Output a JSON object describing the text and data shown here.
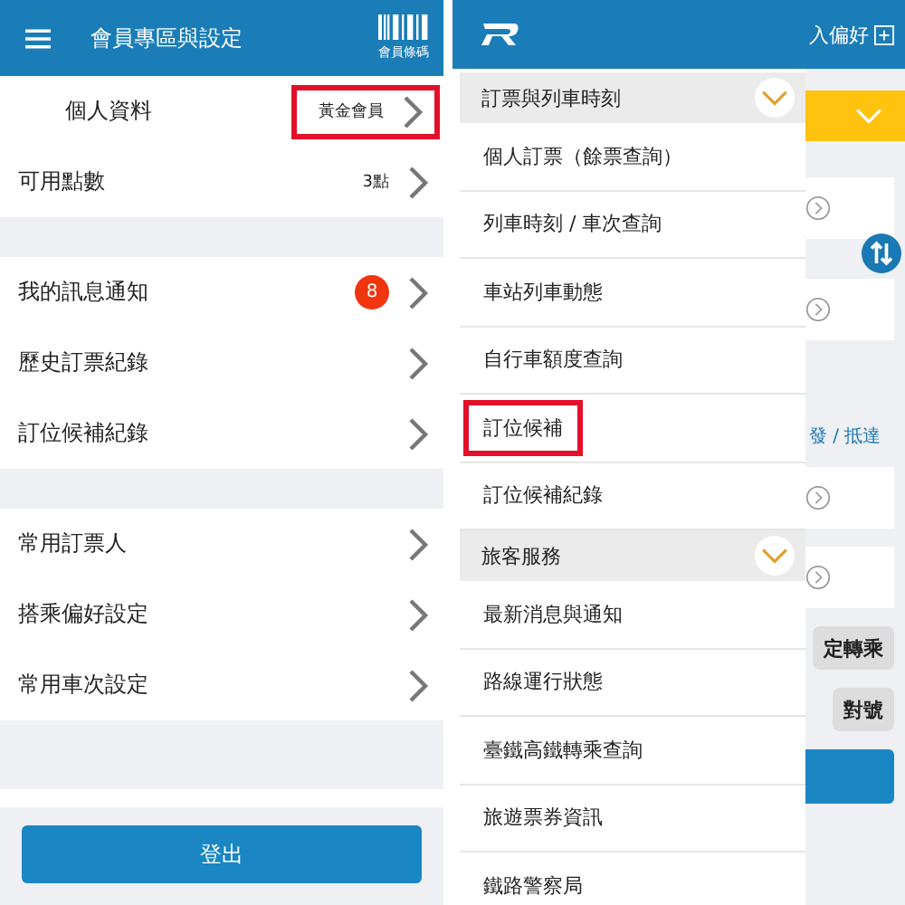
{
  "member_screen": {
    "header": {
      "title": "會員專區與設定",
      "member_code_label": "會員條碼"
    },
    "groups": [
      [
        {
          "label": "個人資料",
          "value": "黃金會員",
          "indented": true,
          "highlighted": true
        },
        {
          "label": "可用點數",
          "value": "3點",
          "indented": false,
          "highlighted": false
        }
      ],
      [
        {
          "label": "我的訊息通知",
          "badge": "8",
          "indented": false,
          "highlighted": false
        },
        {
          "label": "歷史訂票紀錄",
          "indented": false,
          "highlighted": false
        },
        {
          "label": "訂位候補紀錄",
          "indented": false,
          "highlighted": false
        }
      ],
      [
        {
          "label": "常用訂票人",
          "indented": false,
          "highlighted": false
        },
        {
          "label": "搭乘偏好設定",
          "indented": false,
          "highlighted": false
        },
        {
          "label": "常用車次設定",
          "indented": false,
          "highlighted": false
        }
      ]
    ],
    "logout_button": "登出"
  },
  "menu_screen": {
    "header": {
      "favorite_label": "入偏好"
    },
    "drawer": [
      {
        "kind": "section",
        "label": "訂票與列車時刻",
        "expanded": true
      },
      {
        "kind": "item",
        "label": "個人訂票（餘票查詢）",
        "highlighted": false
      },
      {
        "kind": "item",
        "label": "列車時刻 / 車次查詢",
        "highlighted": false
      },
      {
        "kind": "item",
        "label": "車站列車動態",
        "highlighted": false
      },
      {
        "kind": "item",
        "label": "自行車額度查詢",
        "highlighted": false
      },
      {
        "kind": "item",
        "label": "訂位候補",
        "highlighted": true
      },
      {
        "kind": "item",
        "label": "訂位候補紀錄",
        "highlighted": false
      },
      {
        "kind": "section",
        "label": "旅客服務",
        "expanded": true
      },
      {
        "kind": "item",
        "label": "最新消息與通知",
        "highlighted": false
      },
      {
        "kind": "item",
        "label": "路線運行狀態",
        "highlighted": false
      },
      {
        "kind": "item",
        "label": "臺鐵高鐵轉乘查詢",
        "highlighted": false
      },
      {
        "kind": "item",
        "label": "旅遊票券資訊",
        "highlighted": false
      },
      {
        "kind": "item",
        "label": "鐵路警察局",
        "highlighted": false
      }
    ],
    "background": {
      "direction_label": "發 / 抵達",
      "transfer_button": "定轉乘",
      "reserved_button": "對號"
    }
  }
}
